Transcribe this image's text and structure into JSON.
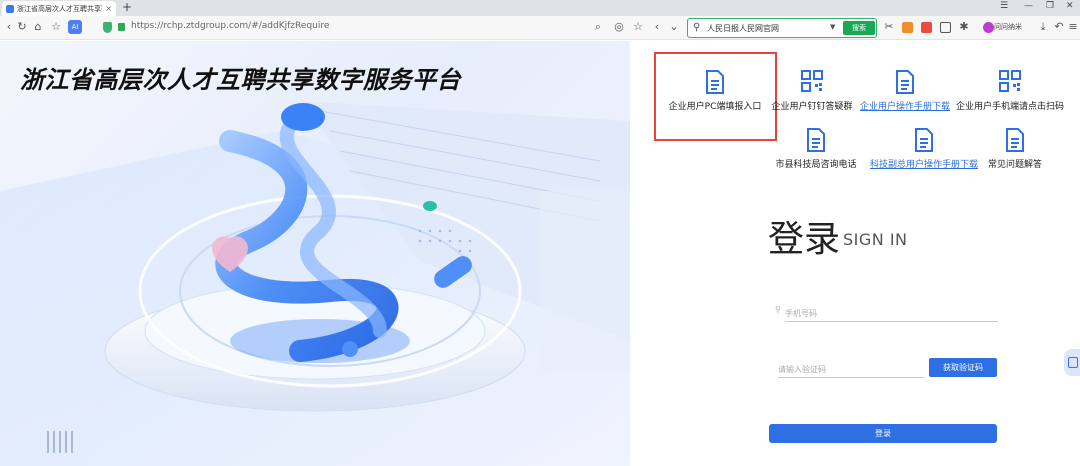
{
  "browser": {
    "tab_title": "浙江省高层次人才互聘共享数",
    "tab_close": "×",
    "new_tab": "+",
    "url": "https://rchp.ztdgroup.com/#/addKjfzRequire",
    "search_value": "人民日报人民网官网",
    "search_button": "搜索",
    "extension_label": "问问纳米"
  },
  "hero": {
    "title": "浙江省高层次人才互聘共享数字服务平台"
  },
  "quick_links": [
    {
      "label": "企业用户PC端填报入口",
      "icon": "document-icon",
      "link": false
    },
    {
      "label": "企业用户钉钉答疑群",
      "icon": "qrcode-icon",
      "link": false
    },
    {
      "label": "企业用户操作手册下载",
      "icon": "document-icon",
      "link": true
    },
    {
      "label": "企业用户手机端请点击扫码",
      "icon": "qrcode-icon",
      "link": false
    },
    {
      "label": "市县科技局咨询电话",
      "icon": "document-icon",
      "link": false
    },
    {
      "label": "科技副总用户操作手册下载",
      "icon": "document-icon",
      "link": true
    },
    {
      "label": "常见问题解答",
      "icon": "document-icon",
      "link": false
    }
  ],
  "login": {
    "title": "登录",
    "subtitle": "SIGN IN",
    "phone_placeholder": "手机号码",
    "code_placeholder": "请输入验证码",
    "code_button": "获取验证码",
    "submit_button": "登录"
  },
  "colors": {
    "accent": "#2f6fe4",
    "link": "#2b6fdd",
    "highlight_border": "#e6413b",
    "search_green": "#1aa854"
  }
}
